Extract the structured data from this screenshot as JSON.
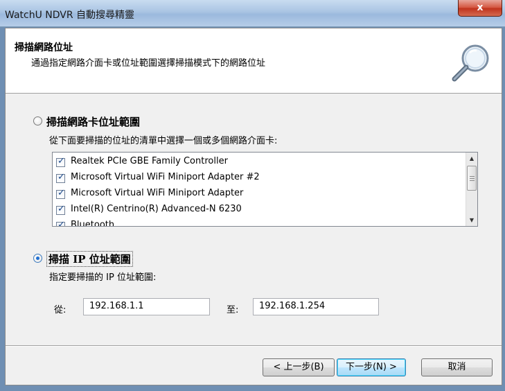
{
  "window": {
    "title": "WatchU NDVR 自動搜尋精靈",
    "close_glyph": "x"
  },
  "header": {
    "title": "掃描網路位址",
    "subtitle": "通過指定網路介面卡或位址範圍選擇掃描模式下的網路位址",
    "icon": "magnifier-icon"
  },
  "option_adapter": {
    "label": "掃描網路卡位址範圍",
    "description": "從下面要掃描的位址的清單中選擇一個或多個網路介面卡:",
    "selected": false,
    "adapters": [
      {
        "name": "Realtek PCIe GBE Family Controller",
        "checked": true
      },
      {
        "name": "Microsoft Virtual WiFi Miniport Adapter #2",
        "checked": true
      },
      {
        "name": "Microsoft Virtual WiFi Miniport Adapter",
        "checked": true
      },
      {
        "name": "Intel(R) Centrino(R) Advanced-N 6230",
        "checked": true
      },
      {
        "name": "Bluetooth",
        "checked": true
      }
    ]
  },
  "option_ip": {
    "label": "掃描 IP 位址範圍",
    "description": "指定要掃描的 IP 位址範圍:",
    "selected": true,
    "from_label": "從:",
    "from_value": "192.168.1.1",
    "to_label": "至:",
    "to_value": "192.168.1.254"
  },
  "buttons": {
    "back": "< 上一步(B)",
    "next": "下一步(N) >",
    "cancel": "取消"
  },
  "colors": {
    "accent": "#1f6fd1",
    "close": "#c0321c"
  }
}
